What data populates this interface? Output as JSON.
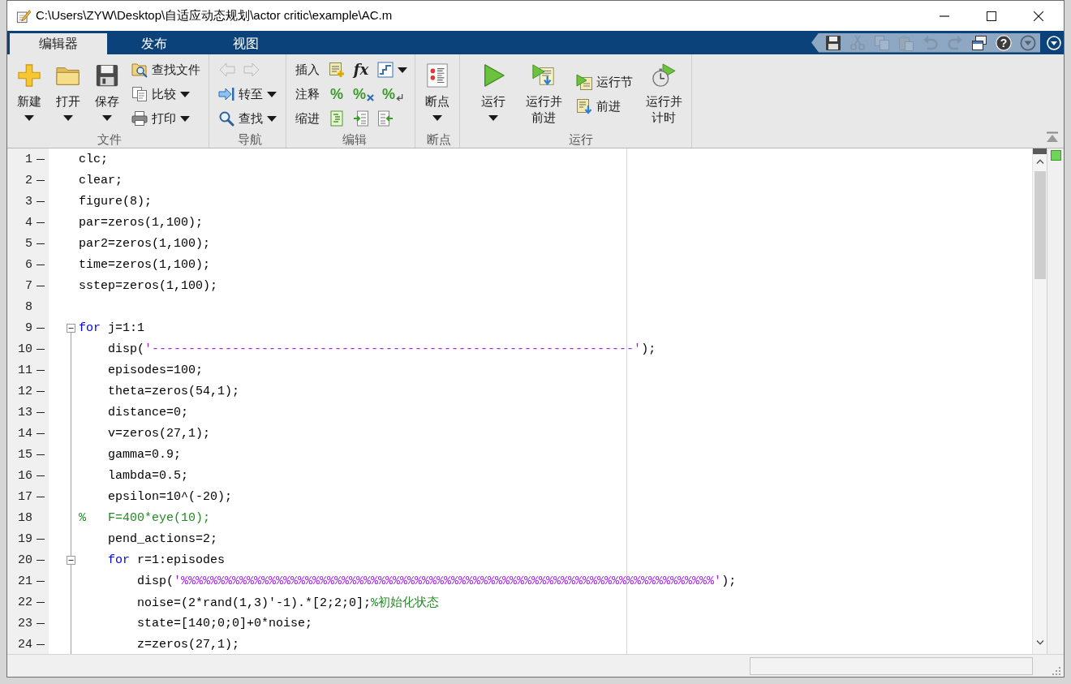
{
  "window": {
    "title": "C:\\Users\\ZYW\\Desktop\\自适应动态规划\\actor critic\\example\\AC.m"
  },
  "tabs": [
    {
      "label": "编辑器",
      "selected": true
    },
    {
      "label": "发布",
      "selected": false
    },
    {
      "label": "视图",
      "selected": false
    }
  ],
  "quick_access": [
    {
      "kind": "save",
      "disabled": false
    },
    {
      "kind": "cut",
      "disabled": true
    },
    {
      "kind": "copy",
      "disabled": true
    },
    {
      "kind": "paste",
      "disabled": true
    },
    {
      "kind": "undo",
      "disabled": true
    },
    {
      "kind": "redo",
      "disabled": true
    },
    {
      "kind": "windows",
      "disabled": false
    },
    {
      "kind": "help",
      "glyph": "?",
      "disabled": false
    },
    {
      "kind": "options",
      "disabled": false
    }
  ],
  "ribbon": {
    "groups": [
      {
        "label": "文件",
        "columns": [
          {
            "kind": "new",
            "label": "新建",
            "dropdown": true
          },
          {
            "kind": "open",
            "label": "打开",
            "dropdown": true
          },
          {
            "kind": "save",
            "label": "保存",
            "dropdown": true
          },
          {
            "rows": [
              {
                "buttons": [
                  {
                    "kind": "find-files",
                    "label": "查找文件",
                    "dropdown": false,
                    "disabled": false
                  }
                ]
              },
              {
                "buttons": [
                  {
                    "kind": "compare",
                    "label": "比较",
                    "dropdown": true,
                    "disabled": false
                  }
                ]
              },
              {
                "buttons": [
                  {
                    "kind": "print",
                    "label": "打印",
                    "dropdown": true,
                    "disabled": false
                  }
                ]
              }
            ]
          }
        ]
      },
      {
        "label": "导航",
        "columns": [
          {
            "rows": [
              {
                "buttons": [
                  {
                    "kind": "back",
                    "dropdown": false,
                    "disabled": true
                  },
                  {
                    "kind": "forward",
                    "dropdown": false,
                    "disabled": true
                  }
                ]
              },
              {
                "buttons": [
                  {
                    "kind": "goto",
                    "label": "转至",
                    "dropdown": true,
                    "disabled": false
                  }
                ]
              },
              {
                "buttons": [
                  {
                    "kind": "find",
                    "label": "查找",
                    "dropdown": true,
                    "disabled": false
                  }
                ]
              }
            ]
          }
        ]
      },
      {
        "label": "编辑",
        "columns": [
          {
            "rows": [
              {
                "label": "插入",
                "buttons": [
                  {
                    "kind": "insert-section",
                    "dropdown": false,
                    "disabled": false
                  },
                  {
                    "kind": "fx",
                    "glyph": "fx",
                    "dropdown": false,
                    "disabled": false
                  },
                  {
                    "kind": "function",
                    "dropdown": true,
                    "disabled": false
                  }
                ]
              },
              {
                "label": "注释",
                "buttons": [
                  {
                    "kind": "comment",
                    "glyph": "%",
                    "dropdown": false,
                    "disabled": false
                  },
                  {
                    "kind": "uncomment",
                    "glyph": "%",
                    "dropdown": false,
                    "disabled": false
                  },
                  {
                    "kind": "wrap-comment",
                    "glyph": "%",
                    "dropdown": false,
                    "disabled": false
                  }
                ]
              },
              {
                "label": "缩进",
                "buttons": [
                  {
                    "kind": "smart-indent",
                    "dropdown": false,
                    "disabled": false
                  },
                  {
                    "kind": "indent",
                    "dropdown": false,
                    "disabled": false
                  },
                  {
                    "kind": "outdent",
                    "dropdown": false,
                    "disabled": false
                  }
                ]
              }
            ]
          }
        ]
      },
      {
        "label": "断点",
        "columns": [
          {
            "kind": "breakpoints",
            "label": "断点",
            "dropdown": true
          }
        ]
      },
      {
        "label": "运行",
        "columns": [
          {
            "kind": "run",
            "label": "运行",
            "dropdown": true
          },
          {
            "kind": "run-advance",
            "label": "运行并前进",
            "dropdown": false
          },
          {
            "rows": [
              {
                "buttons": [
                  {
                    "kind": "run-section",
                    "label": "运行节",
                    "dropdown": false,
                    "disabled": false
                  }
                ]
              },
              {
                "buttons": [
                  {
                    "kind": "advance",
                    "label": "前进",
                    "dropdown": false,
                    "disabled": false
                  }
                ]
              }
            ]
          },
          {
            "kind": "run-time",
            "label": "运行并计时",
            "dropdown": false
          }
        ]
      }
    ]
  },
  "editor": {
    "lines": [
      {
        "number": "1",
        "executable": true,
        "segments": [
          {
            "kind": "plain",
            "text": "clc;"
          }
        ]
      },
      {
        "number": "2",
        "executable": true,
        "segments": [
          {
            "kind": "plain",
            "text": "clear;"
          }
        ]
      },
      {
        "number": "3",
        "executable": true,
        "segments": [
          {
            "kind": "plain",
            "text": "figure(8);"
          }
        ]
      },
      {
        "number": "4",
        "executable": true,
        "segments": [
          {
            "kind": "plain",
            "text": "par=zeros(1,100);"
          }
        ]
      },
      {
        "number": "5",
        "executable": true,
        "segments": [
          {
            "kind": "plain",
            "text": "par2=zeros(1,100);"
          }
        ]
      },
      {
        "number": "6",
        "executable": true,
        "segments": [
          {
            "kind": "plain",
            "text": "time=zeros(1,100);"
          }
        ]
      },
      {
        "number": "7",
        "executable": true,
        "segments": [
          {
            "kind": "plain",
            "text": "sstep=zeros(1,100);"
          }
        ]
      },
      {
        "number": "8",
        "executable": false
      },
      {
        "number": "9",
        "executable": true,
        "expanded": true,
        "segments": [
          {
            "kind": "keyword",
            "text": "for"
          },
          {
            "kind": "plain",
            "text": " j=1:1"
          }
        ],
        "children": [
          {
            "number": "10",
            "executable": true,
            "segments": [
              {
                "kind": "plain",
                "text": "disp("
              },
              {
                "kind": "string",
                "text": "'------------------------------------------------------------------'"
              },
              {
                "kind": "plain",
                "text": ");"
              }
            ]
          },
          {
            "number": "11",
            "executable": true,
            "segments": [
              {
                "kind": "plain",
                "text": "episodes=100;"
              }
            ]
          },
          {
            "number": "12",
            "executable": true,
            "segments": [
              {
                "kind": "plain",
                "text": "theta=zeros(54,1);"
              }
            ]
          },
          {
            "number": "13",
            "executable": true,
            "segments": [
              {
                "kind": "plain",
                "text": "distance=0;"
              }
            ]
          },
          {
            "number": "14",
            "executable": true,
            "segments": [
              {
                "kind": "plain",
                "text": "v=zeros(27,1);"
              }
            ]
          },
          {
            "number": "15",
            "executable": true,
            "segments": [
              {
                "kind": "plain",
                "text": "gamma=0.9;"
              }
            ]
          },
          {
            "number": "16",
            "executable": true,
            "segments": [
              {
                "kind": "plain",
                "text": "lambda=0.5;"
              }
            ]
          },
          {
            "number": "17",
            "executable": true,
            "segments": [
              {
                "kind": "plain",
                "text": "epsilon=10^(-20);"
              }
            ]
          },
          {
            "number": "18",
            "executable": false,
            "comment_prefix": "%",
            "segments": [
              {
                "kind": "comment",
                "text": "F=400*eye(10);"
              }
            ]
          },
          {
            "number": "19",
            "executable": true,
            "segments": [
              {
                "kind": "plain",
                "text": "pend_actions=2;"
              }
            ]
          },
          {
            "number": "20",
            "executable": true,
            "expanded": true,
            "segments": [
              {
                "kind": "keyword",
                "text": "for"
              },
              {
                "kind": "plain",
                "text": " r=1:episodes"
              }
            ],
            "children": [
              {
                "number": "21",
                "executable": true,
                "segments": [
                  {
                    "kind": "plain",
                    "text": "disp("
                  },
                  {
                    "kind": "string",
                    "text": "'%%%%%%%%%%%%%%%%%%%%%%%%%%%%%%%%%%%%%%%%%%%%%%%%%%%%%%%%%%%%%%%%%%%%%%%%%'"
                  },
                  {
                    "kind": "plain",
                    "text": ");"
                  }
                ]
              },
              {
                "number": "22",
                "executable": true,
                "segments": [
                  {
                    "kind": "plain",
                    "text": "noise=(2*rand(1,3)'-1).*[2;2;0];"
                  },
                  {
                    "kind": "comment",
                    "text": "%初始化状态"
                  }
                ]
              },
              {
                "number": "23",
                "executable": true,
                "segments": [
                  {
                    "kind": "plain",
                    "text": "state=[140;0;0]+0*noise;"
                  }
                ]
              },
              {
                "number": "24",
                "executable": true,
                "segments": [
                  {
                    "kind": "plain",
                    "text": "z=zeros(27,1);"
                  }
                ]
              }
            ]
          }
        ]
      }
    ]
  }
}
